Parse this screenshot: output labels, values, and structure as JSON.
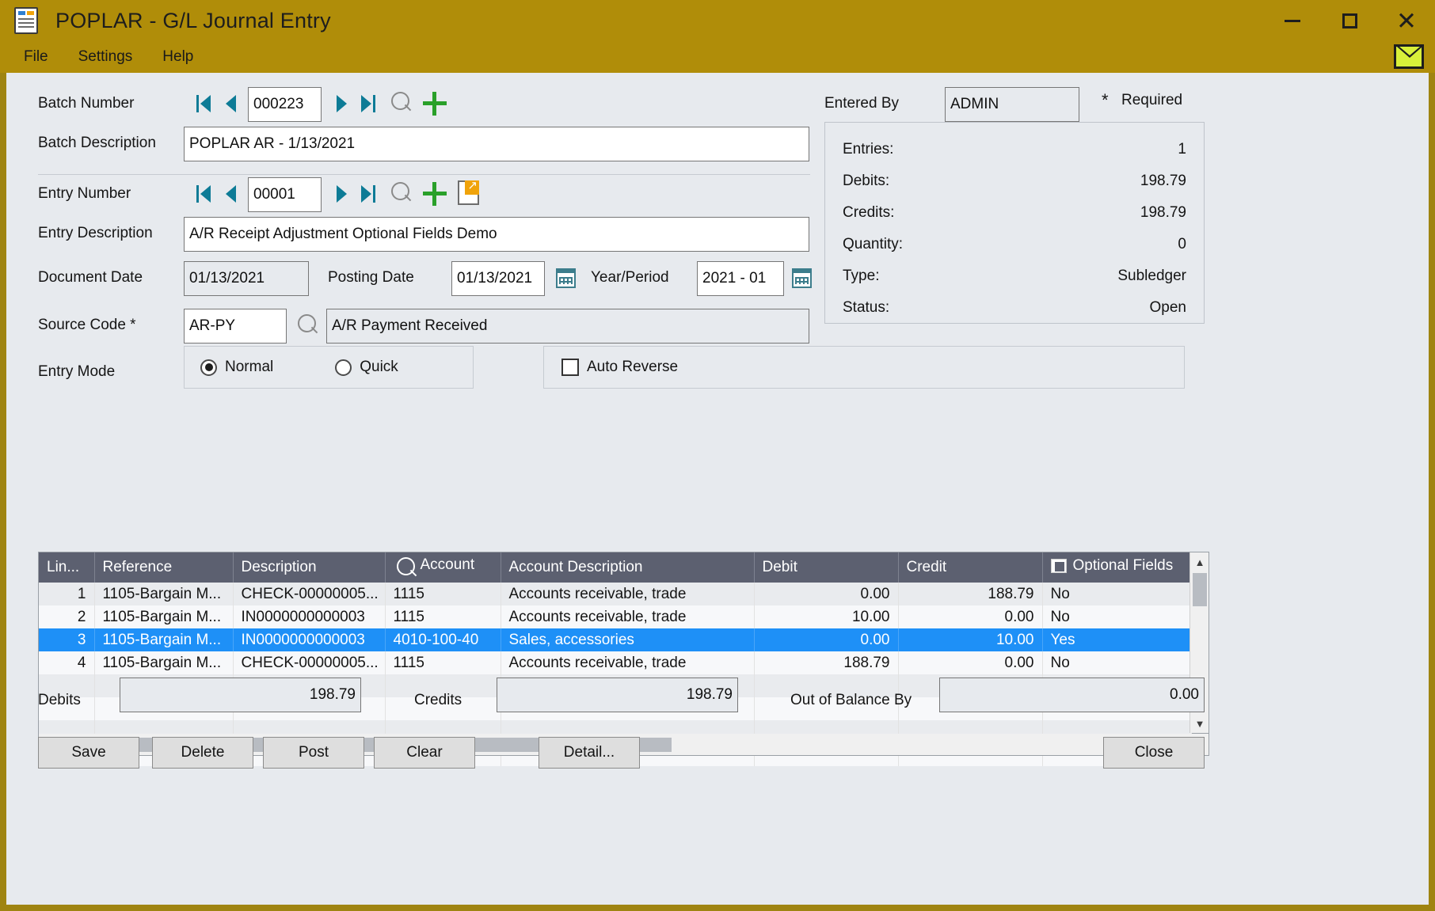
{
  "window": {
    "title": "POPLAR - G/L Journal Entry",
    "icon": "journal-icon",
    "minimize": "—",
    "maximize": "□",
    "close": "✕"
  },
  "menu": {
    "items": [
      "File",
      "Settings",
      "Help"
    ],
    "mail_icon": "mail-envelope-icon"
  },
  "form": {
    "batch_number_label": "Batch Number",
    "batch_number_value": "000223",
    "batch_description_label": "Batch Description",
    "batch_description_value": "POPLAR AR -  1/13/2021",
    "entry_number_label": "Entry Number",
    "entry_number_value": "00001",
    "entry_description_label": "Entry Description",
    "entry_description_value": "A/R Receipt Adjustment Optional Fields Demo",
    "document_date_label": "Document Date",
    "document_date_value": "01/13/2021",
    "posting_date_label": "Posting Date",
    "posting_date_value": "01/13/2021",
    "year_period_label": "Year/Period",
    "year_period_value": "2021 - 01",
    "source_code_label": "Source Code *",
    "source_code_value": "AR-PY",
    "source_code_description": "A/R Payment Received",
    "entry_mode_label": "Entry Mode",
    "entry_mode_normal": "Normal",
    "entry_mode_quick": "Quick",
    "entry_mode_selected": "Normal",
    "auto_reverse_label": "Auto Reverse",
    "auto_reverse_checked": false,
    "entered_by_label": "Entered By",
    "entered_by_value": "ADMIN",
    "required_note": "Required",
    "required_marker": "*"
  },
  "summary": {
    "rows": [
      {
        "key": "Entries:",
        "value": "1"
      },
      {
        "key": "Debits:",
        "value": "198.79"
      },
      {
        "key": "Credits:",
        "value": "198.79"
      },
      {
        "key": "Quantity:",
        "value": "0"
      },
      {
        "key": "Type:",
        "value": "Subledger"
      },
      {
        "key": "Status:",
        "value": "Open"
      }
    ]
  },
  "grid": {
    "columns": [
      {
        "label": "Lin...",
        "align": "right",
        "icon": null
      },
      {
        "label": "Reference",
        "align": "left",
        "icon": null
      },
      {
        "label": "Description",
        "align": "left",
        "icon": null
      },
      {
        "label": "Account",
        "align": "left",
        "icon": "search-icon"
      },
      {
        "label": "Account Description",
        "align": "left",
        "icon": null
      },
      {
        "label": "Debit",
        "align": "right",
        "icon": null
      },
      {
        "label": "Credit",
        "align": "right",
        "icon": null
      },
      {
        "label": "Optional Fields",
        "align": "left",
        "icon": "optional-fields-icon"
      }
    ],
    "rows": [
      {
        "line": "1",
        "reference": "1105-Bargain M...",
        "description": "CHECK-00000005...",
        "account": "1115",
        "account_description": "Accounts receivable, trade",
        "debit": "0.00",
        "credit": "188.79",
        "optional_fields": "No",
        "selected": false
      },
      {
        "line": "2",
        "reference": "1105-Bargain M...",
        "description": "IN0000000000003",
        "account": "1115",
        "account_description": "Accounts receivable, trade",
        "debit": "10.00",
        "credit": "0.00",
        "optional_fields": "No",
        "selected": false
      },
      {
        "line": "3",
        "reference": "1105-Bargain M...",
        "description": "IN0000000000003",
        "account": "4010-100-40",
        "account_description": "Sales, accessories",
        "debit": "0.00",
        "credit": "10.00",
        "optional_fields": "Yes",
        "selected": true
      },
      {
        "line": "4",
        "reference": "1105-Bargain M...",
        "description": "CHECK-00000005...",
        "account": "1115",
        "account_description": "Accounts receivable, trade",
        "debit": "188.79",
        "credit": "0.00",
        "optional_fields": "No",
        "selected": false
      }
    ],
    "empty_row_count": 4
  },
  "totals": {
    "debits_label": "Debits",
    "debits_value": "198.79",
    "credits_label": "Credits",
    "credits_value": "198.79",
    "out_of_balance_label": "Out of Balance By",
    "out_of_balance_value": "0.00"
  },
  "buttons": {
    "save": "Save",
    "delete": "Delete",
    "post": "Post",
    "clear": "Clear",
    "detail": "Detail...",
    "close": "Close"
  },
  "colors": {
    "title_bar": "#b08d09",
    "client_bg": "#e7eaee",
    "grid_header": "#5c6070",
    "row_selected": "#1e90f7",
    "nav_arrow": "#0d7b96",
    "plus_green": "#2aa02a",
    "drill_orange": "#f0a30a"
  }
}
